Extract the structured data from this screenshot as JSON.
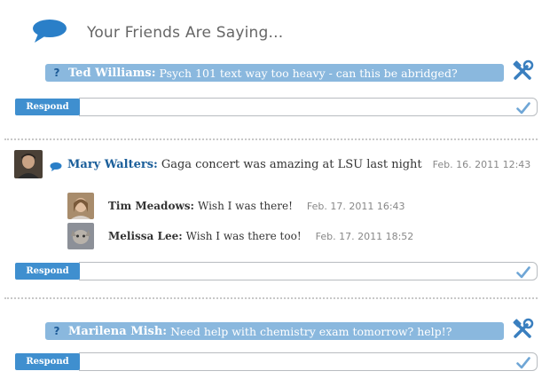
{
  "header": {
    "title": "Your Friends Are Saying..."
  },
  "questions": [
    {
      "mark": "?",
      "name": "Ted Williams:",
      "text": "Psych 101 text way too heavy - can this be abridged?"
    },
    {
      "mark": "?",
      "name": "Marilena Mish:",
      "text": "Need help with chemistry exam tomorrow? help!?"
    }
  ],
  "post": {
    "name": "Mary Walters:",
    "text": "Gaga concert was amazing at LSU last night",
    "time": "Feb. 16. 2011 12:43",
    "replies": [
      {
        "name": "Tim Meadows:",
        "text": "Wish I was there!",
        "time": "Feb. 17. 2011 16:43"
      },
      {
        "name": "Melissa Lee:",
        "text": "Wish I was there too!",
        "time": "Feb. 17. 2011 18:52"
      }
    ]
  },
  "respond": {
    "label": "Respond"
  },
  "colors": {
    "accent": "#3f8fcf",
    "question_bar": "#8ab8de",
    "name_link": "#1a5e9a"
  },
  "icons": {
    "header": "speech-bubble-icon",
    "tools": "tools-icon",
    "check": "checkmark-icon"
  }
}
